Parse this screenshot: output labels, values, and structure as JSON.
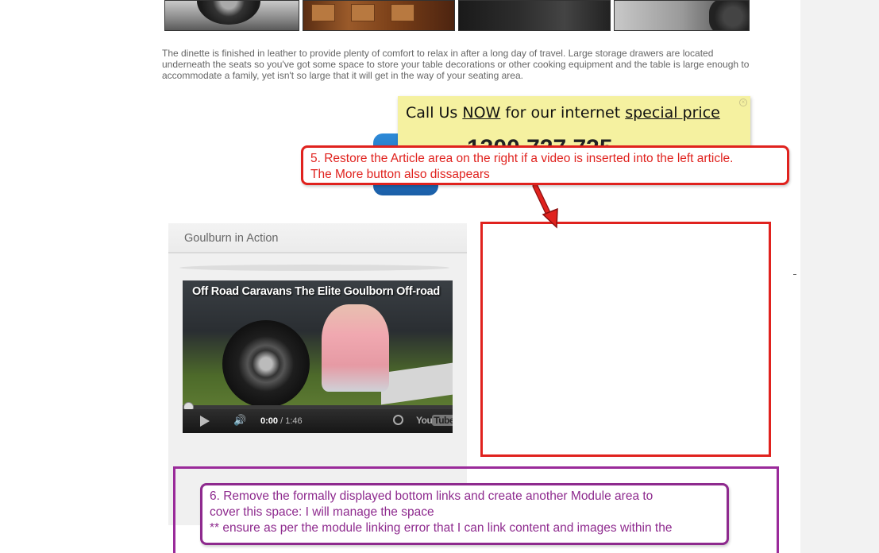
{
  "article": {
    "paragraph": "The dinette is finished in leather to provide plenty of comfort to relax in after a long day of travel. Large storage drawers are located underneath the seats so you've got some space to store your table decorations or other cooking equipment and the table is large enough to accommodate a family, yet isn't so large that it will get in the way of your seating area."
  },
  "sticky": {
    "part1": "Call Us ",
    "now": "NOW",
    "part2": " for our internet ",
    "special": "special price",
    "close": "×",
    "phone": "1300 727 735"
  },
  "annotation_red": {
    "line1": "5. Restore the Article area on the right if a video is inserted into the left article.",
    "line2": "The More button also dissapears"
  },
  "module": {
    "title": "Goulburn in Action"
  },
  "video": {
    "title": "Off Road Caravans The Elite Goulborn Off-road",
    "current_time": "0:00",
    "separator": " / ",
    "duration": "1:46",
    "brand_you": "You",
    "brand_tube": "Tube",
    "progress": 0.0
  },
  "annotation_purple": {
    "line1": "6. Remove the formally displayed bottom links and create another Module area to",
    "line2": "cover this space: I will manage the space",
    "line3": "** ensure as per the module linking error that I can link content and images within the"
  },
  "colors": {
    "annotation_red": "#e0221e",
    "annotation_purple": "#8e2a8e",
    "sticky_yellow": "#f5f1a0",
    "body_text": "#666666"
  },
  "icons": [
    "play-icon",
    "volume-icon",
    "clock-icon",
    "youtube-logo-icon",
    "phone-icon",
    "close-icon"
  ]
}
